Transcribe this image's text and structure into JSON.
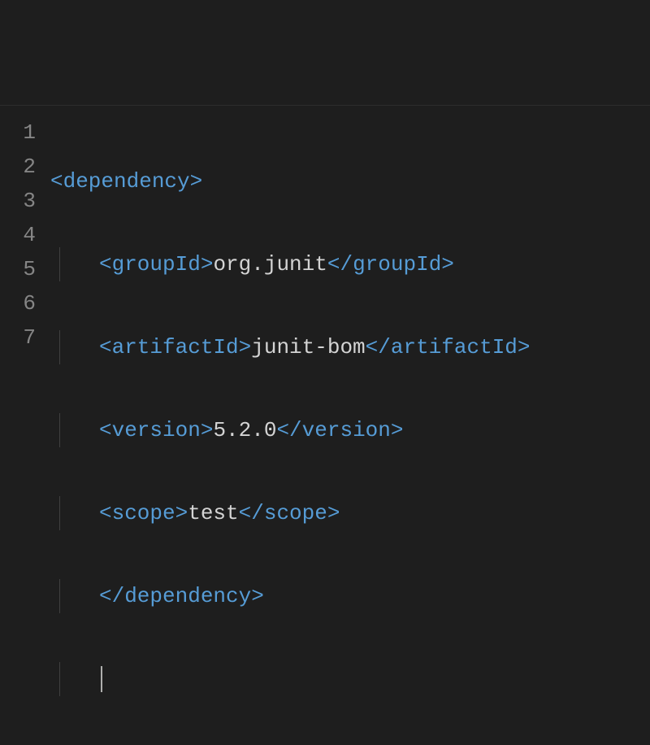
{
  "editor": {
    "lineNumbers": [
      "1",
      "2",
      "3",
      "4",
      "5",
      "6",
      "7"
    ],
    "lines": [
      {
        "indent": 0,
        "tokens": [
          {
            "kind": "tag",
            "t": "<dependency>"
          }
        ]
      },
      {
        "indent": 1,
        "guide": true,
        "tokens": [
          {
            "kind": "tag",
            "t": "<groupId>"
          },
          {
            "kind": "txt",
            "t": "org.junit"
          },
          {
            "kind": "tag",
            "t": "</groupId>"
          }
        ]
      },
      {
        "indent": 1,
        "guide": true,
        "tokens": [
          {
            "kind": "tag",
            "t": "<artifactId>"
          },
          {
            "kind": "txt",
            "t": "junit-bom"
          },
          {
            "kind": "tag",
            "t": "</artifactId>"
          }
        ]
      },
      {
        "indent": 1,
        "guide": true,
        "tokens": [
          {
            "kind": "tag",
            "t": "<version>"
          },
          {
            "kind": "txt",
            "t": "5.2.0"
          },
          {
            "kind": "tag",
            "t": "</version>"
          }
        ]
      },
      {
        "indent": 1,
        "guide": true,
        "tokens": [
          {
            "kind": "tag",
            "t": "<scope>"
          },
          {
            "kind": "txt",
            "t": "test"
          },
          {
            "kind": "tag",
            "t": "</scope>"
          }
        ]
      },
      {
        "indent": 1,
        "guide": true,
        "tokens": [
          {
            "kind": "tag",
            "t": "</dependency>"
          }
        ]
      },
      {
        "indent": 1,
        "guide": true,
        "cursor": true,
        "tokens": []
      }
    ]
  }
}
